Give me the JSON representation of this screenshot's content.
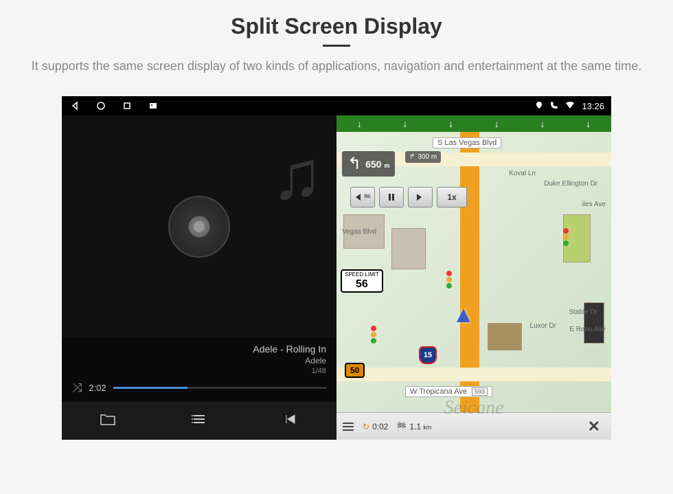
{
  "header": {
    "title": "Split Screen Display",
    "subtitle": "It supports the same screen display of two kinds of applications, navigation and entertainment at the same time."
  },
  "statusbar": {
    "time": "13:26"
  },
  "music": {
    "track": "Adele - Rolling In",
    "artist": "Adele",
    "track_count": "1/48",
    "elapsed": "2:02"
  },
  "nav": {
    "street_top": "S Las Vegas Blvd",
    "street_bottom": "W Tropicana Ave",
    "street_bottom_num": "593",
    "turn_distance": "650",
    "turn_unit": "m",
    "next_turn_distance": "300",
    "next_turn_unit": "m",
    "speed_limit_label": "SPEED LIMIT",
    "speed_limit_value": "56",
    "route_number": "50",
    "interstate": "15",
    "playback_speed": "1x",
    "poi_vegas": "Vegas Blvd",
    "poi_duke": "Duke Ellington Dr",
    "poi_koval": "Koval Ln",
    "poi_luxor": "Luxor Dr",
    "poi_stable": "Stable Dr",
    "poi_reno": "E Reno Ave",
    "poi_miles": "iles Ave",
    "bottom_time": "0:02",
    "bottom_dist": "1.1",
    "bottom_dist_unit": "km"
  },
  "watermark": "Seicane"
}
